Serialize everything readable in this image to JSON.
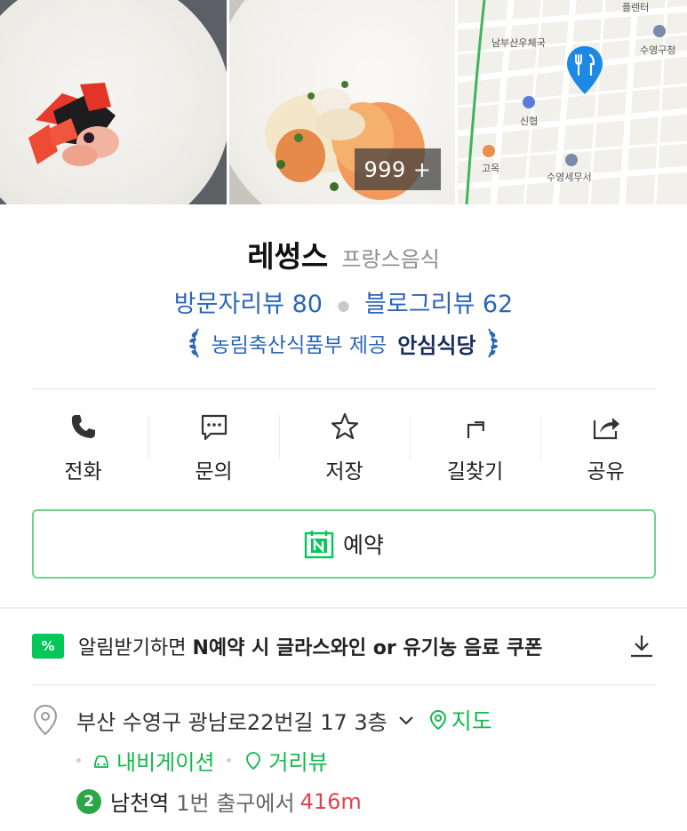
{
  "photos": {
    "count_badge": "999 +",
    "map": {
      "labels": [
        "남부산우체국",
        "수영구청",
        "신협",
        "고옥",
        "수영세무서",
        "플렌터"
      ]
    }
  },
  "place": {
    "name": "레썽스",
    "category": "프랑스음식",
    "visitor_review": "방문자리뷰 80",
    "blog_review": "블로그리뷰 62",
    "certification_prefix": "농림축산식품부 제공",
    "certification_name": "안심식당"
  },
  "actions": [
    {
      "label": "전화",
      "icon": "phone-icon"
    },
    {
      "label": "문의",
      "icon": "chat-icon"
    },
    {
      "label": "저장",
      "icon": "star-icon"
    },
    {
      "label": "길찾기",
      "icon": "directions-icon"
    },
    {
      "label": "공유",
      "icon": "share-icon"
    }
  ],
  "reserve": {
    "label": "예약",
    "icon": "naver-booking-icon"
  },
  "coupon": {
    "badge": "%",
    "text_prefix": "알림받기하면 ",
    "text_bold": "N예약 시 글라스와인 or 유기농 음료 쿠폰"
  },
  "address": {
    "text": "부산 수영구 광남로22번길 17 3층",
    "map_link": "지도",
    "navigation": "내비게이션",
    "street_view": "거리뷰"
  },
  "subway": {
    "line": "2",
    "station": "남천역",
    "exit": "1번 출구에서",
    "distance": "416m",
    "line_color": "#2ba545"
  },
  "colors": {
    "accent_green": "#14b84c",
    "review_blue": "#2c66b8",
    "distance_red": "#e4434b"
  }
}
